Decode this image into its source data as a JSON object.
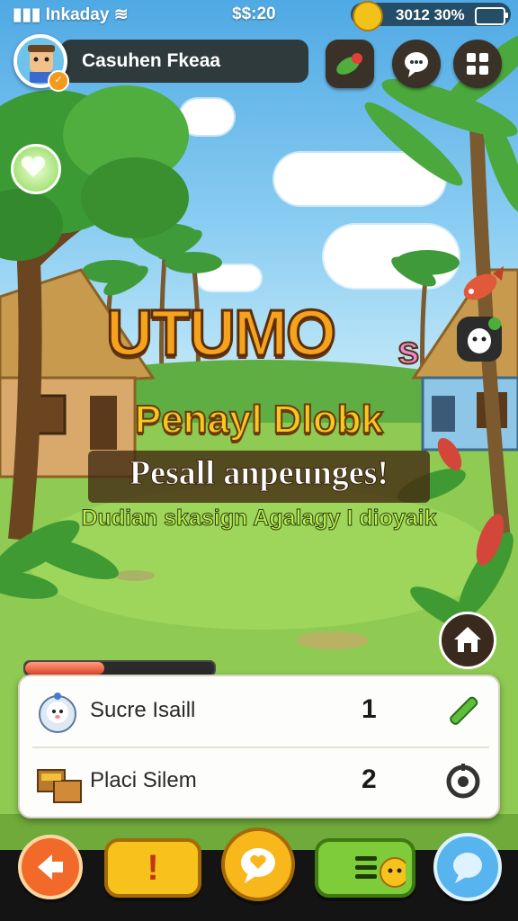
{
  "status_bar": {
    "carrier": "Inkaday",
    "time": "$$:20",
    "currency": "3012 30%"
  },
  "player": {
    "name": "Casuhen Fkeaa",
    "badge": "✓"
  },
  "title": {
    "logo": "UTUMO",
    "logo_suffix": "s",
    "line1": "Penayl Dlobk",
    "line2": "Pesall anpeunges!",
    "line3": "Dudian skasign Agalagy I dioyaik"
  },
  "progress": {
    "value": 0.42
  },
  "quest_panel": {
    "rows": [
      {
        "label": "Sucre Isaill",
        "count": "1",
        "icon": "snowman-icon",
        "action": "pencil-icon"
      },
      {
        "label": "Placi Silem",
        "count": "2",
        "icon": "crate-icon",
        "action": "settings-icon"
      }
    ]
  },
  "bottom_nav": [
    {
      "icon": "back-arrow-icon",
      "color": "#f26a2a"
    },
    {
      "icon": "exclamation-icon",
      "label": "!",
      "color": "#f8c21c"
    },
    {
      "icon": "heart-chat-icon",
      "color": "#f8b81c"
    },
    {
      "icon": "menu-list-icon",
      "color": "#7fcc3a"
    },
    {
      "icon": "chat-bubble-icon",
      "color": "#58b4ee"
    }
  ],
  "colors": {
    "accent": "#f7a21c",
    "panel": "#fdfdfb",
    "sky": "#4fa9e4",
    "grass": "#86c34a"
  }
}
